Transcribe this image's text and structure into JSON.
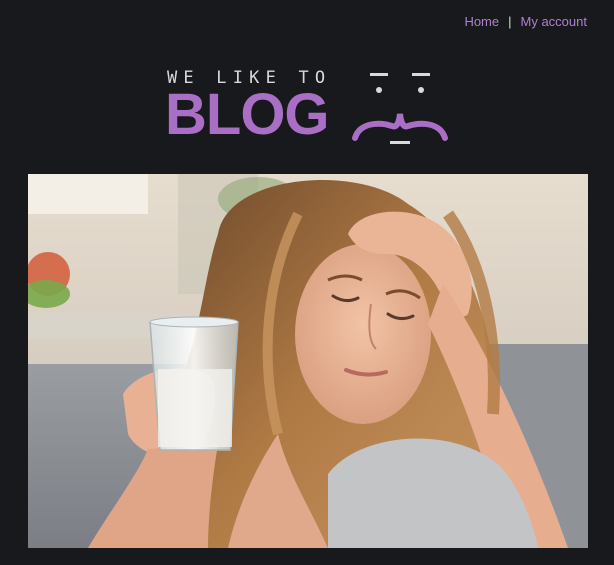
{
  "nav": {
    "home_label": "Home",
    "separator": "|",
    "account_label": "My account"
  },
  "logo": {
    "tagline": "WE LIKE TO",
    "wordmark": "BLOG",
    "icon": "face-icon"
  },
  "hero": {
    "icon": "hero-photo",
    "description_colors": {
      "background_wall": "#d8cdbb",
      "sofa": "#8e9196",
      "hair": "#a8723c",
      "skin": "#e8b394"
    }
  },
  "colors": {
    "background": "#18191c",
    "accent": "#a86fc4",
    "link": "#b07fd0",
    "text_light": "#d9d9d9"
  }
}
